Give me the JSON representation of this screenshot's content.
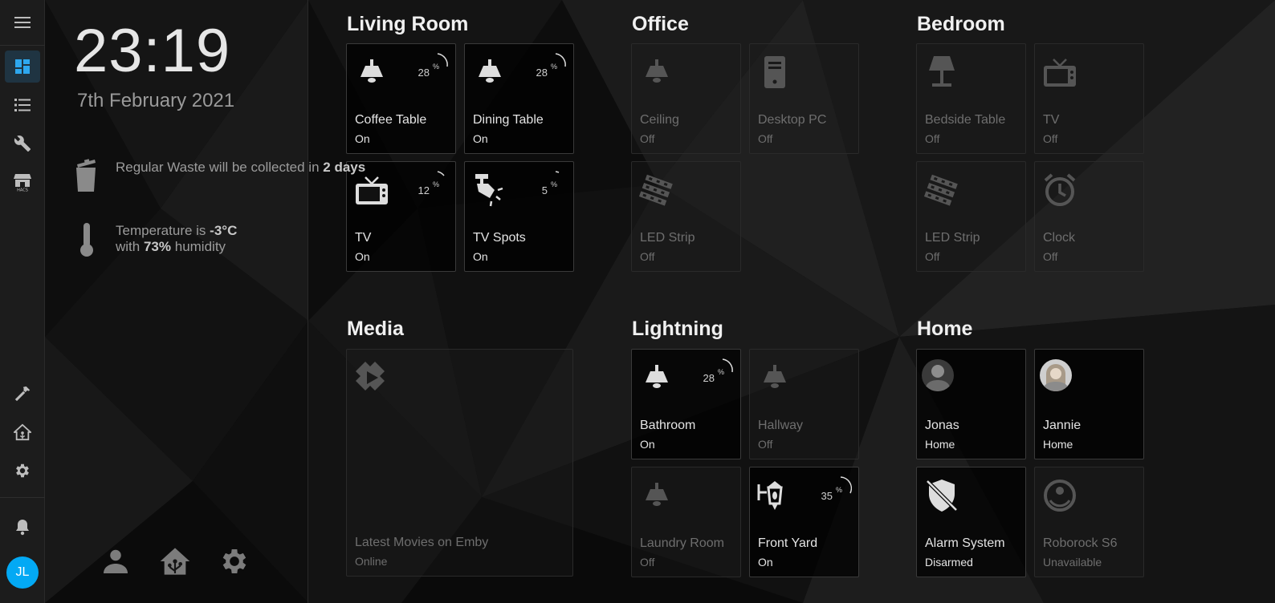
{
  "colors": {
    "accent": "#03a9f4",
    "tile_on_text": "#e4e4e4",
    "tile_off_text": "#6e6e6e"
  },
  "sidebar": {
    "items": [
      {
        "icon": "menu-icon"
      },
      {
        "icon": "dashboard-icon"
      },
      {
        "icon": "list-icon"
      },
      {
        "icon": "wrench-icon"
      },
      {
        "icon": "hacs-store-icon",
        "label": "HACS"
      },
      {
        "icon": "hammer-icon"
      },
      {
        "icon": "home-assistant-icon"
      },
      {
        "icon": "gear-icon"
      },
      {
        "icon": "bell-icon"
      }
    ],
    "user_initials": "JL"
  },
  "panel": {
    "time": "23:19",
    "date": "7th February 2021",
    "waste": {
      "pre": "Regular Waste will be collected in",
      "value": "2 days"
    },
    "weather": {
      "pre": "Temperature is",
      "temp": "-3°C",
      "mid": "with",
      "humidity": "73%",
      "post": "humidity"
    }
  },
  "groups": [
    {
      "title": "Living Room",
      "tiles": [
        {
          "name": "Coffee Table",
          "state": "On",
          "icon": "ceiling-lamp-icon",
          "brightness": 28
        },
        {
          "name": "Dining Table",
          "state": "On",
          "icon": "ceiling-lamp-icon",
          "brightness": 28
        },
        {
          "name": "TV",
          "state": "On",
          "icon": "tv-icon",
          "brightness": 12
        },
        {
          "name": "TV Spots",
          "state": "On",
          "icon": "spotlight-icon",
          "brightness": 5
        }
      ]
    },
    {
      "title": "Office",
      "tiles": [
        {
          "name": "Ceiling",
          "state": "Off",
          "icon": "ceiling-lamp-icon"
        },
        {
          "name": "Desktop PC",
          "state": "Off",
          "icon": "desktop-tower-icon"
        },
        {
          "name": "LED Strip",
          "state": "Off",
          "icon": "led-strip-icon"
        }
      ]
    },
    {
      "title": "Bedroom",
      "tiles": [
        {
          "name": "Bedside Table",
          "state": "Off",
          "icon": "table-lamp-icon"
        },
        {
          "name": "TV",
          "state": "Off",
          "icon": "tv-icon"
        },
        {
          "name": "LED Strip",
          "state": "Off",
          "icon": "led-strip-icon"
        },
        {
          "name": "Clock",
          "state": "Off",
          "icon": "alarm-clock-icon"
        }
      ]
    },
    {
      "title": "Media",
      "tiles": [
        {
          "name": "Latest Movies on Emby",
          "state": "Online",
          "icon": "emby-icon"
        }
      ]
    },
    {
      "title": "Lightning",
      "tiles": [
        {
          "name": "Bathroom",
          "state": "On",
          "icon": "ceiling-lamp-icon",
          "brightness": 28
        },
        {
          "name": "Hallway",
          "state": "Off",
          "icon": "ceiling-lamp-icon"
        },
        {
          "name": "Laundry Room",
          "state": "Off",
          "icon": "ceiling-lamp-icon"
        },
        {
          "name": "Front Yard",
          "state": "On",
          "icon": "outdoor-lamp-icon",
          "brightness": 35
        }
      ]
    },
    {
      "title": "Home",
      "tiles": [
        {
          "name": "Jonas",
          "state": "Home",
          "icon": "person-photo"
        },
        {
          "name": "Jannie",
          "state": "Home",
          "icon": "person-photo"
        },
        {
          "name": "Alarm System",
          "state": "Disarmed",
          "icon": "shield-off-icon"
        },
        {
          "name": "Roborock S6",
          "state": "Unavailable",
          "icon": "robot-vacuum-icon"
        }
      ]
    }
  ]
}
